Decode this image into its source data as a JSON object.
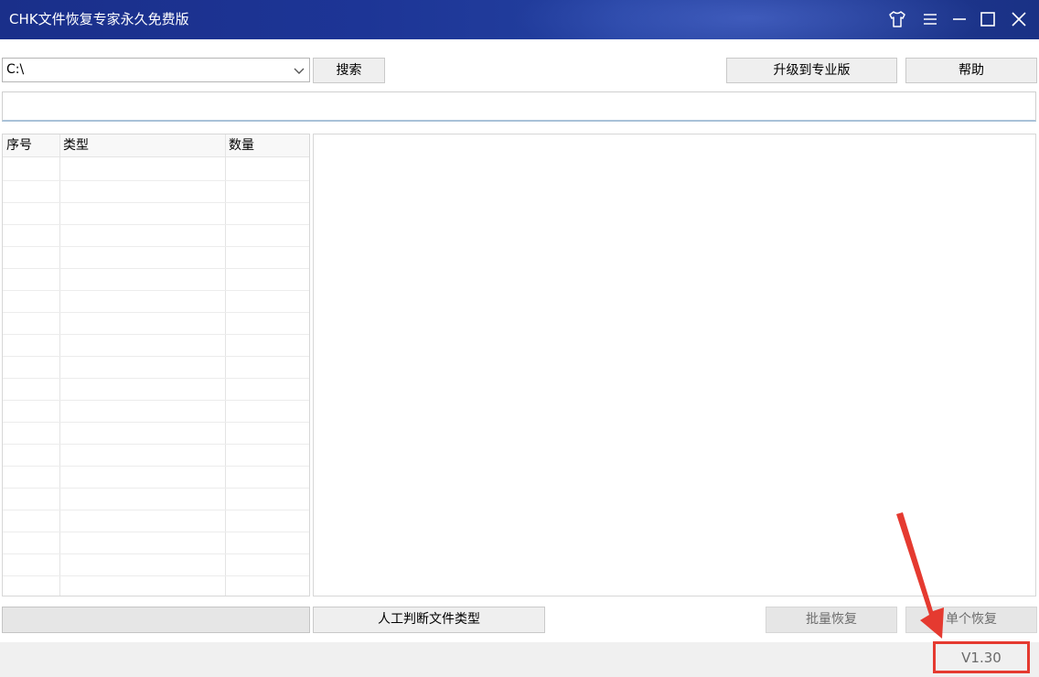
{
  "window": {
    "title": "CHK文件恢复专家永久免费版",
    "icons": [
      "tshirt-skin-icon",
      "menu-icon",
      "minimize-icon",
      "maximize-icon",
      "close-icon"
    ]
  },
  "toolbar": {
    "drive_value": "C:\\",
    "search_label": "搜索",
    "upgrade_label": "升级到专业版",
    "help_label": "帮助"
  },
  "path_box": {
    "value": ""
  },
  "list": {
    "columns": [
      "序号",
      "类型",
      "数量"
    ],
    "rows": []
  },
  "bottom": {
    "manual_type_label": "人工判断文件类型",
    "batch_recover_label": "批量恢复",
    "single_recover_label": "单个恢复"
  },
  "status": {
    "version": "V1.30"
  },
  "colors": {
    "titlebar": "#1d3596",
    "annotation_red": "#e53a30"
  }
}
